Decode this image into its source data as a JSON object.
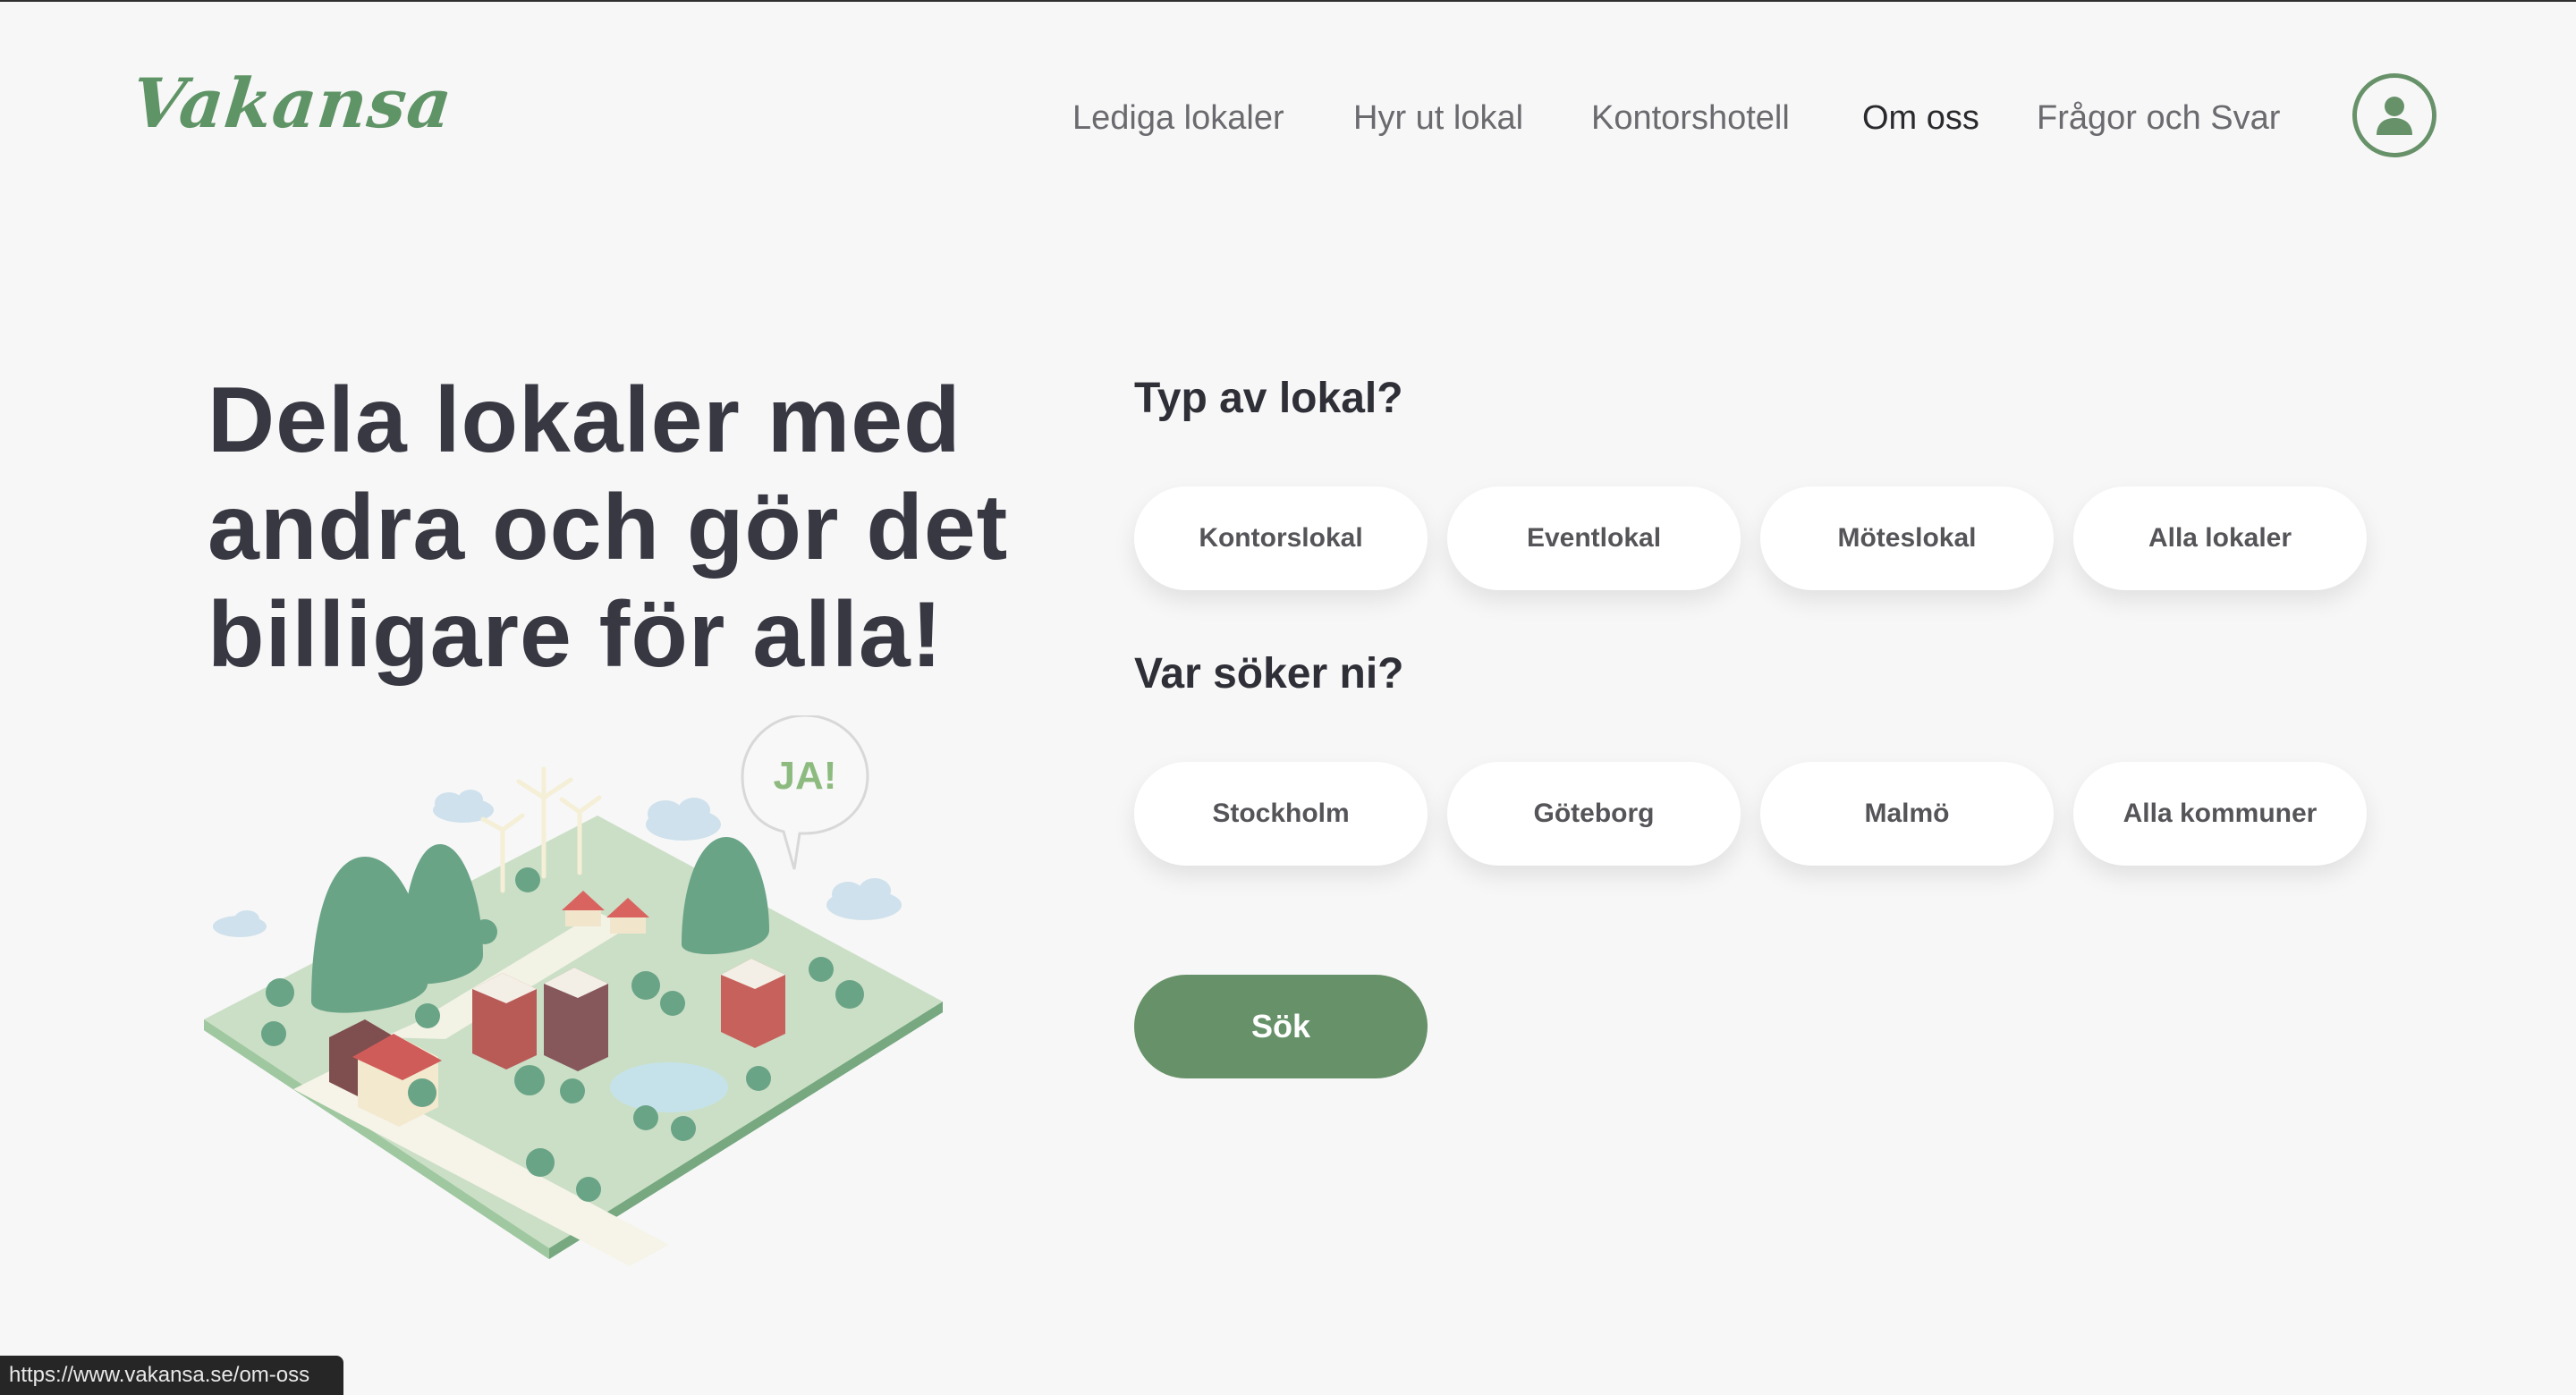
{
  "header": {
    "logo_text": "Vakansa",
    "nav": [
      {
        "label": "Lediga lokaler",
        "active": false
      },
      {
        "label": "Hyr ut lokal",
        "active": false
      },
      {
        "label": "Kontorshotell",
        "active": false
      },
      {
        "label": "Om oss",
        "active": true
      },
      {
        "label": "Frågor och Svar",
        "active": false
      }
    ],
    "profile_icon": "user-icon"
  },
  "hero": {
    "title_lines": [
      "Dela lokaler med",
      "andra och gör det",
      "billigare för alla!"
    ],
    "speech_bubble": "JA!"
  },
  "search": {
    "type_heading": "Typ av lokal?",
    "type_options": [
      "Kontorslokal",
      "Eventlokal",
      "Möteslokal",
      "Alla lokaler"
    ],
    "location_heading": "Var söker ni?",
    "location_options": [
      "Stockholm",
      "Göteborg",
      "Malmö",
      "Alla kommuner"
    ],
    "submit_label": "Sök"
  },
  "status_bar": {
    "url": "https://www.vakansa.se/om-oss"
  },
  "colors": {
    "brand_green": "#679269",
    "text_dark": "#383843",
    "background": "#f7f7f7"
  }
}
